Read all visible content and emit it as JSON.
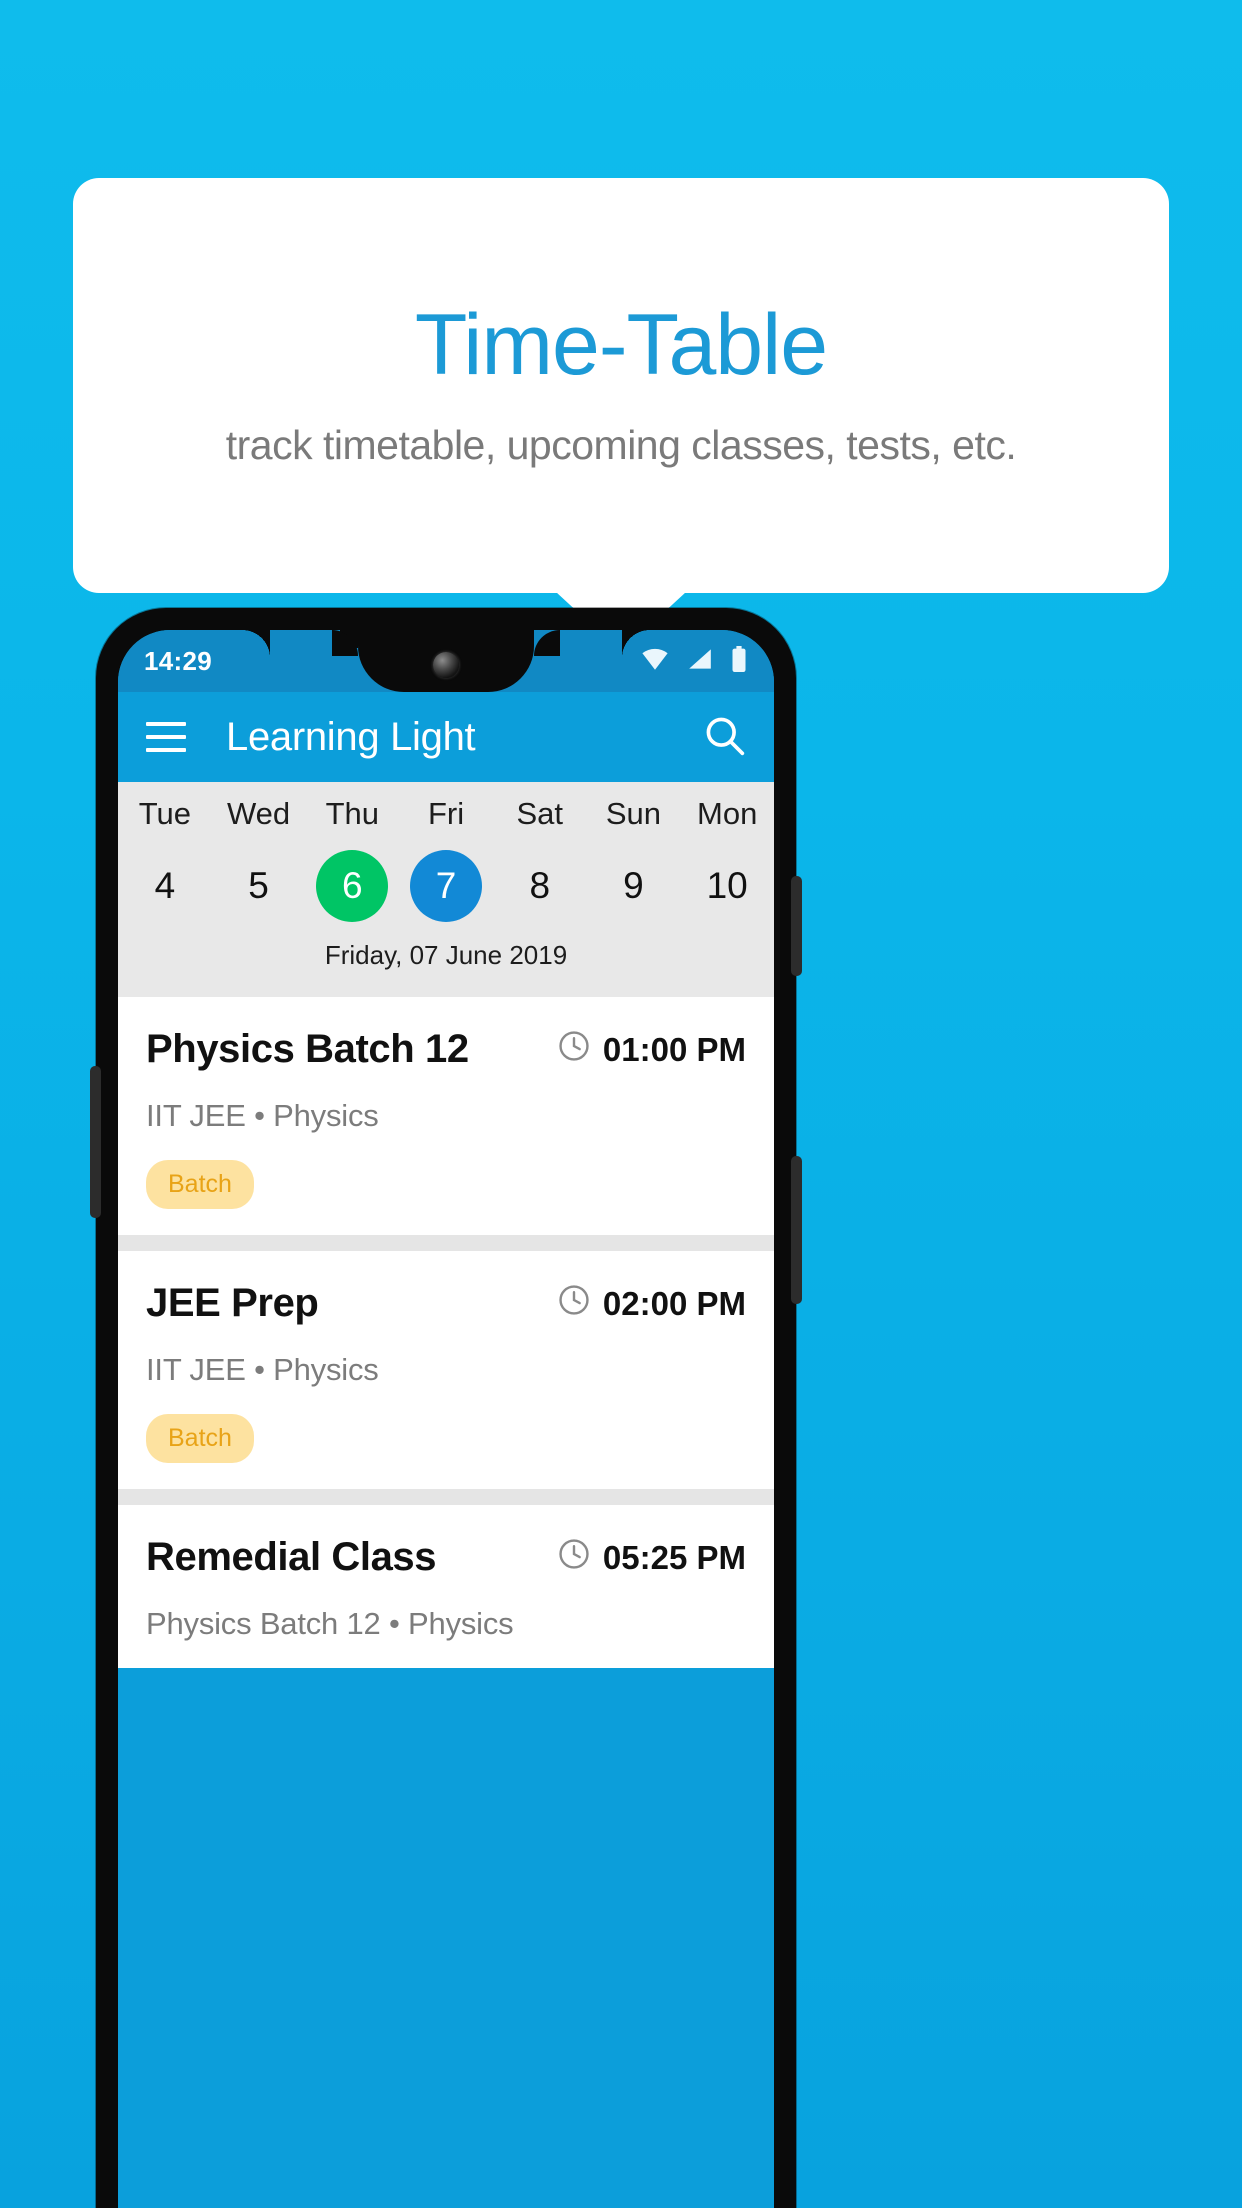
{
  "promo": {
    "title": "Time-Table",
    "subtitle": "track timetable, upcoming classes, tests, etc.",
    "title_color": "#1c9ad6",
    "card_bg": "#ffffff",
    "page_bg": "#0bb6ea"
  },
  "phone": {
    "status_bar": {
      "time": "14:29",
      "icons": [
        "wifi-icon",
        "signal-icon",
        "battery-icon"
      ],
      "bg": "#1189c4"
    },
    "app_bar": {
      "menu_icon": "hamburger-menu-icon",
      "title": "Learning Light",
      "search_icon": "search-icon",
      "bg": "#0c9eda"
    },
    "date_strip": {
      "bg": "#e8e8e8",
      "days": [
        "Tue",
        "Wed",
        "Thu",
        "Fri",
        "Sat",
        "Sun",
        "Mon"
      ],
      "dates": [
        {
          "num": "4",
          "state": "normal"
        },
        {
          "num": "5",
          "state": "normal"
        },
        {
          "num": "6",
          "state": "today"
        },
        {
          "num": "7",
          "state": "selected"
        },
        {
          "num": "8",
          "state": "normal"
        },
        {
          "num": "9",
          "state": "normal"
        },
        {
          "num": "10",
          "state": "normal"
        }
      ],
      "today_color": "#00c565",
      "selected_color": "#1289d6",
      "caption": "Friday, 07 June 2019"
    },
    "classes": [
      {
        "title": "Physics Batch 12",
        "time": "01:00 PM",
        "time_icon": "clock-icon",
        "subtitle": "IIT JEE • Physics",
        "badge": "Batch"
      },
      {
        "title": "JEE Prep",
        "time": "02:00 PM",
        "time_icon": "clock-icon",
        "subtitle": "IIT JEE • Physics",
        "badge": "Batch"
      },
      {
        "title": "Remedial Class",
        "time": "05:25 PM",
        "time_icon": "clock-icon",
        "subtitle": "Physics Batch 12 • Physics",
        "badge": ""
      }
    ],
    "badge_bg": "#fde2a0",
    "badge_color": "#e8a317"
  }
}
